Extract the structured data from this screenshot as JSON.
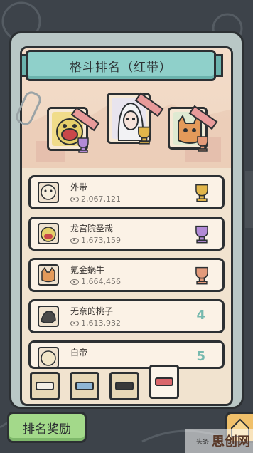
{
  "header": {
    "title": "格斗排名（红带）"
  },
  "podium": [
    {
      "place": 2,
      "trophy": "silver-trophy-icon",
      "color": "#b28ad6"
    },
    {
      "place": 1,
      "trophy": "gold-trophy-icon",
      "color": "#e2b64a"
    },
    {
      "place": 3,
      "trophy": "bronze-trophy-icon",
      "color": "#e39a7a"
    }
  ],
  "ranking": [
    {
      "name": "外带",
      "views": "2,067,121",
      "rank_icon": "gold-trophy-icon",
      "color": "#e2b64a"
    },
    {
      "name": "龙宫院圣哉",
      "views": "1,673,159",
      "rank_icon": "silver-trophy-icon",
      "color": "#b28ad6"
    },
    {
      "name": "氪金蜗牛",
      "views": "1,664,456",
      "rank_icon": "bronze-trophy-icon",
      "color": "#e39a7a"
    },
    {
      "name": "无奈的桃子",
      "views": "1,613,932",
      "rank": "4"
    },
    {
      "name": "白帝",
      "views": "",
      "rank": "5"
    }
  ],
  "tabs": [
    {
      "id": "white-belt",
      "color": "#f4efe6",
      "active": false
    },
    {
      "id": "blue-belt",
      "color": "#8fb6d6",
      "active": false
    },
    {
      "id": "black-belt",
      "color": "#3a3a3a",
      "active": false
    },
    {
      "id": "red-belt",
      "color": "#d9666b",
      "active": true
    }
  ],
  "footer": {
    "reward_label": "排名奖励"
  },
  "watermark": {
    "small": "头条",
    "text": "思创网"
  }
}
